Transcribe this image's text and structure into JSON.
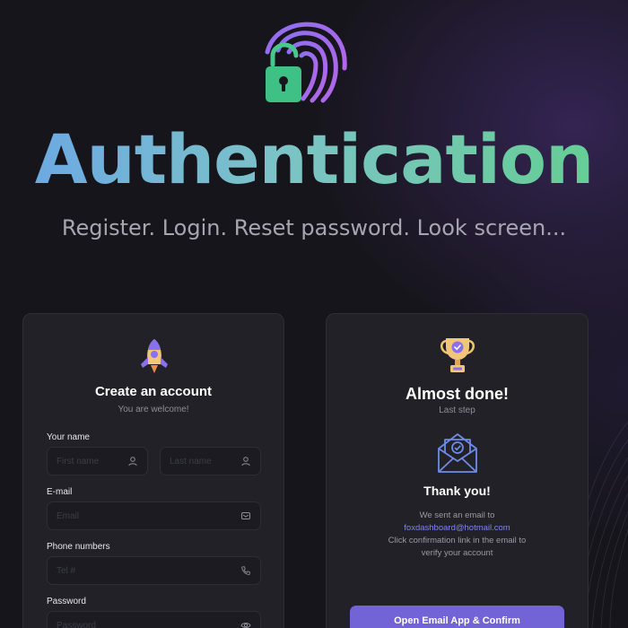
{
  "hero": {
    "title": "Authentication",
    "subtitle": "Register. Login. Reset password. Look screen..."
  },
  "register": {
    "title": "Create an account",
    "subtitle": "You are welcome!",
    "name_label": "Your name",
    "first_name_placeholder": "First name",
    "last_name_placeholder": "Last name",
    "email_label": "E-mail",
    "email_placeholder": "Email",
    "phone_label": "Phone numbers",
    "phone_placeholder": "Tel #",
    "password_label": "Password",
    "password_placeholder": "Password"
  },
  "confirm": {
    "title": "Almost done!",
    "subtitle": "Last step",
    "thank_title": "Thank you!",
    "message_line1": "We sent an email to",
    "email": "foxdashboard@hotmail.com",
    "message_line2": "Click confirmation link in the email to",
    "message_line3": "verify your account",
    "button_label": "Open Email App & Confirm"
  },
  "colors": {
    "background": "#16151b",
    "card": "#212127",
    "accent": "#7263d6",
    "link": "#7f86e8",
    "gradient_start": "#6aa6e6",
    "gradient_end": "#62cf8f"
  },
  "icons": {
    "hero": "fingerprint-lock-icon",
    "register": "rocket-icon",
    "confirm": "trophy-icon",
    "envelope": "envelope-check-icon",
    "user": "user-icon",
    "mail": "mail-icon",
    "phone": "phone-icon",
    "eye": "eye-icon"
  }
}
